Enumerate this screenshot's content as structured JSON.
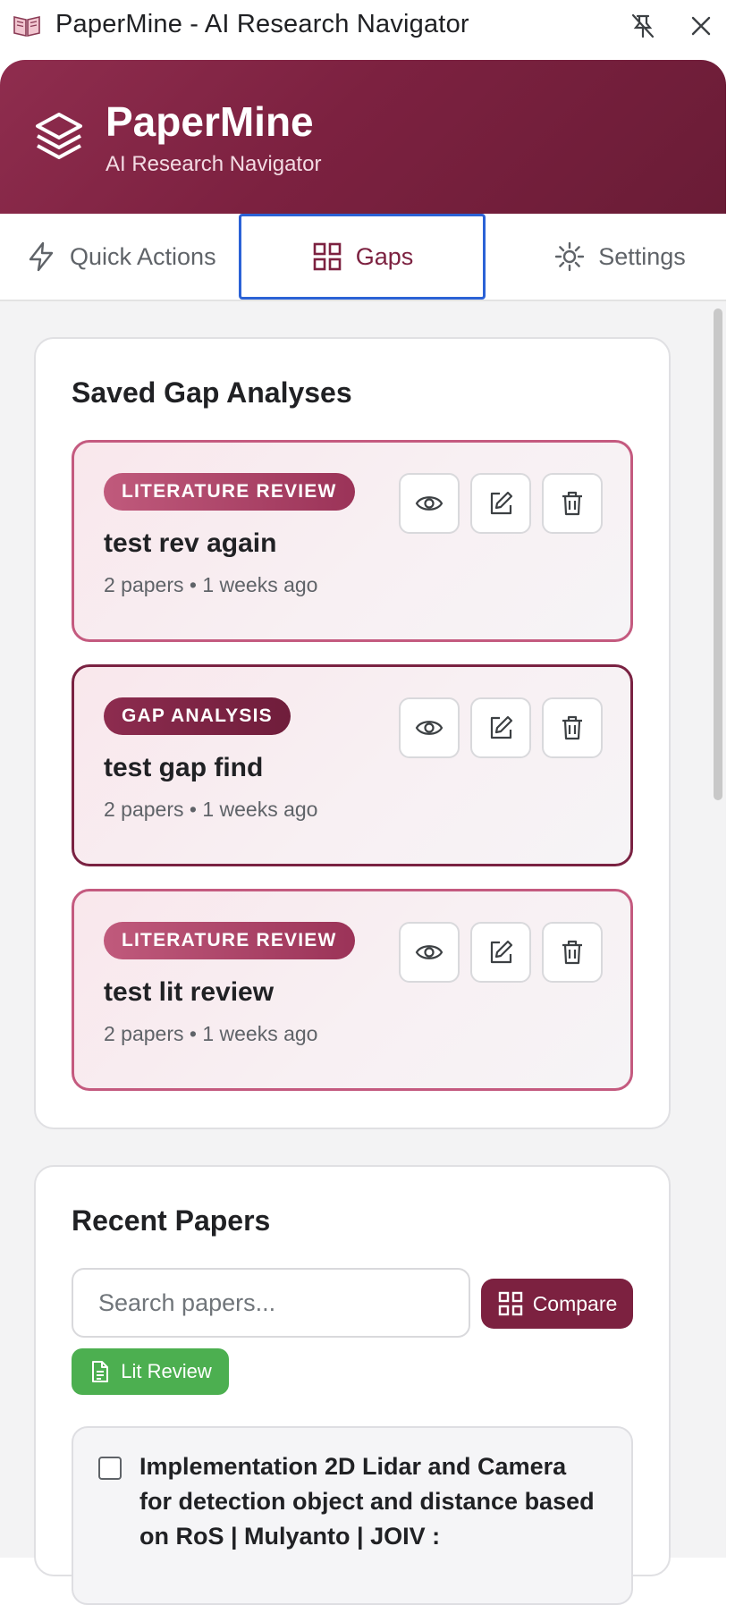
{
  "window": {
    "title": "PaperMine - AI Research Navigator",
    "icons": [
      "book-icon",
      "unpin-icon",
      "close-icon"
    ]
  },
  "header": {
    "brand": "PaperMine",
    "tagline": "AI Research Navigator",
    "logo_icon": "layers-icon"
  },
  "tabs": [
    {
      "label": "Quick Actions",
      "icon": "lightning-icon",
      "active": false
    },
    {
      "label": "Gaps",
      "icon": "grid-icon",
      "active": true
    },
    {
      "label": "Settings",
      "icon": "gear-icon",
      "active": false
    }
  ],
  "saved": {
    "title": "Saved Gap Analyses",
    "cards": [
      {
        "type_label": "LITERATURE REVIEW",
        "title": "test rev again",
        "meta": "2 papers • 1 weeks ago"
      },
      {
        "type_label": "GAP ANALYSIS",
        "title": "test gap find",
        "meta": "2 papers • 1 weeks ago"
      },
      {
        "type_label": "LITERATURE REVIEW",
        "title": "test lit review",
        "meta": "2 papers • 1 weeks ago"
      }
    ]
  },
  "recent": {
    "title": "Recent Papers",
    "search_placeholder": "Search papers...",
    "compare_label": "Compare",
    "lit_review_label": "Lit Review",
    "papers": [
      {
        "title": "Implementation 2D Lidar and Camera for detection object and distance based on RoS | Mulyanto | JOIV :",
        "checked": false
      }
    ]
  },
  "colors": {
    "brand": "#7c2140",
    "literature_badge": "#b14a6e",
    "gap_badge": "#7a2242",
    "active_tab_outline": "#2b62d6",
    "lit_review_button": "#4caf50"
  }
}
